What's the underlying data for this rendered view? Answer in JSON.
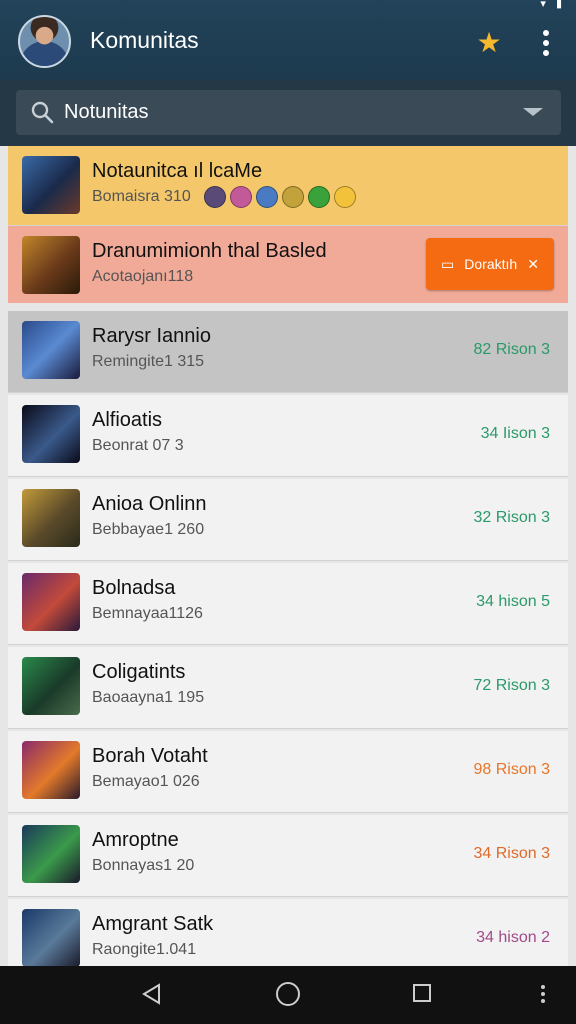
{
  "app": {
    "title": "Komunitas"
  },
  "search": {
    "value": "Notunitas"
  },
  "featured": [
    {
      "title": "Notaunitca ıl lcaMe",
      "sub": "Bomaisra 310",
      "badge_colors": [
        "#5a4a78",
        "#c25a9a",
        "#4a7ac2",
        "#c2a23a",
        "#3aa23a",
        "#f2c23a"
      ]
    },
    {
      "title": "Dranumimionh thal Basled",
      "sub": "Acotaojanı118",
      "button_label": "Doraktıh",
      "button_color": "#f56b12"
    }
  ],
  "items": [
    {
      "title": "Rarysr Iannio",
      "sub": "Remingite1 315",
      "meta": "82 Rison 3",
      "meta_color": "#2a9a6a",
      "active": true
    },
    {
      "title": "Alfioatis",
      "sub": "Beonrat 07 3",
      "meta": "34 Iison 3",
      "meta_color": "#2a9a6a"
    },
    {
      "title": "Anioa Onlinn",
      "sub": "Bebbayae1 260",
      "meta": "32 Rison 3",
      "meta_color": "#2a9a6a"
    },
    {
      "title": "Bolnadsa",
      "sub": "Bemnayaa1126",
      "meta": "34 hison 5",
      "meta_color": "#2a9a6a"
    },
    {
      "title": "Coligatints",
      "sub": "Baoaayna1 195",
      "meta": "72 Rison 3",
      "meta_color": "#2a9a6a"
    },
    {
      "title": "Borah Votaht",
      "sub": "Bemayao1 026",
      "meta": "98 Rison 3",
      "meta_color": "#e8762a"
    },
    {
      "title": "Amroptne",
      "sub": "Bonnayas1 20",
      "meta": "34 Rison 3",
      "meta_color": "#e06a2a"
    },
    {
      "title": "Amgrant Satk",
      "sub": "Raongite1.041",
      "meta": "34 hison 2",
      "meta_color": "#a04a8a"
    }
  ]
}
